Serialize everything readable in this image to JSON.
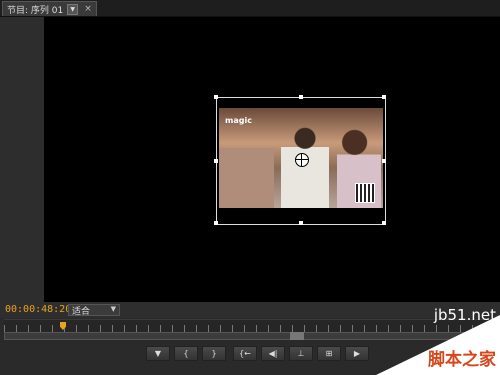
{
  "tab": {
    "label": "节目: 序列 01",
    "menu_icon": "chevron-down-icon",
    "close_icon": "close-icon"
  },
  "controls": {
    "timecode": "00:00:48:20",
    "fit_value": "适合"
  },
  "transport": [
    {
      "name": "marker-button",
      "icon": "marker-icon",
      "glyph": "▼"
    },
    {
      "name": "mark-in-button",
      "icon": "mark-in-icon",
      "glyph": "{"
    },
    {
      "name": "mark-out-button",
      "icon": "mark-out-icon",
      "glyph": "}"
    },
    {
      "name": "go-to-in-button",
      "icon": "go-to-in-icon",
      "glyph": "{←"
    },
    {
      "name": "step-back-button",
      "icon": "step-back-icon",
      "glyph": "◀|"
    },
    {
      "name": "lift-button",
      "icon": "lift-icon",
      "glyph": "⊥"
    },
    {
      "name": "extract-button",
      "icon": "extract-icon",
      "glyph": "⊞"
    },
    {
      "name": "play-button",
      "icon": "play-icon",
      "glyph": "▶"
    }
  ],
  "watermark": {
    "domain": "jb51.net",
    "name": "脚本之家"
  }
}
